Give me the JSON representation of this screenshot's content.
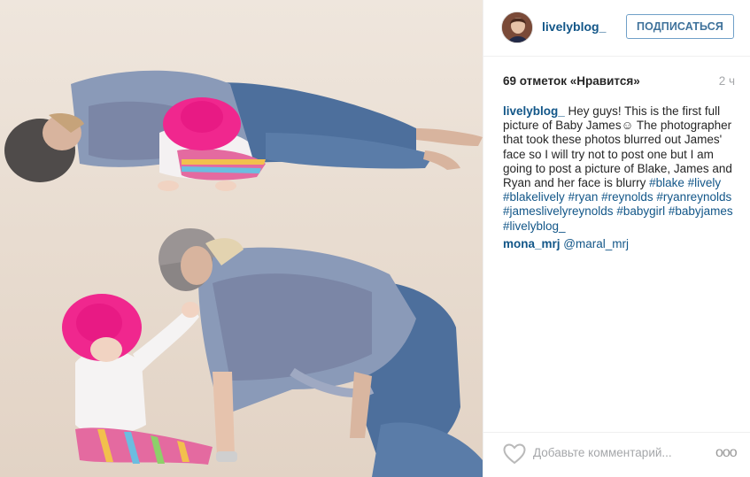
{
  "post": {
    "username": "livelyblog_",
    "follow_label": "ПОДПИСАТЬСЯ",
    "likes": "69 отметок «Нравится»",
    "time": "2 ч",
    "caption": {
      "username": "livelyblog_",
      "text": "Hey guys! This is the first full picture of Baby James☺ The photographer that took these photos blurred out James' face so I will try not to post one but I am going to post a picture of Blake, James and Ryan and her face is blurry",
      "hashtags": [
        "#blake",
        "#lively",
        "#blakelively",
        "#ryan",
        "#reynolds",
        "#ryanreynolds",
        "#jameslivelyreynolds",
        "#babygirl",
        "#babyjames",
        "#livelyblog_"
      ]
    },
    "comments": [
      {
        "username": "mona_mrj",
        "text": "@maral_mrj"
      }
    ],
    "add_comment_placeholder": "Добавьте комментарий...",
    "more_label": "ooo"
  }
}
